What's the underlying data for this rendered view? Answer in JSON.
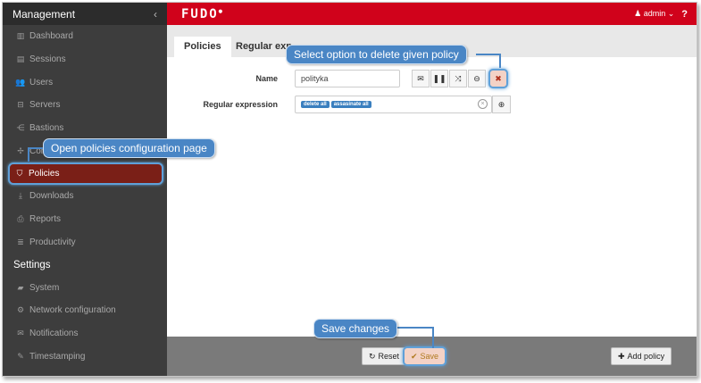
{
  "sidebar": {
    "header": "Management",
    "header_chevron": "‹",
    "items": [
      {
        "label": "Dashboard",
        "icon": "▥"
      },
      {
        "label": "Sessions",
        "icon": "▤"
      },
      {
        "label": "Users",
        "icon": "👥"
      },
      {
        "label": "Servers",
        "icon": "⊟"
      },
      {
        "label": "Bastions",
        "icon": "⋲"
      },
      {
        "label": "Con",
        "icon": "✢"
      },
      {
        "label": "Policies",
        "icon": "⛉"
      },
      {
        "label": "Downloads",
        "icon": "⤓"
      },
      {
        "label": "Reports",
        "icon": "⎙"
      },
      {
        "label": "Productivity",
        "icon": "≣"
      }
    ],
    "settings_header": "Settings",
    "settings_items": [
      {
        "label": "System",
        "icon": "▰"
      },
      {
        "label": "Network configuration",
        "icon": "⚙"
      },
      {
        "label": "Notifications",
        "icon": "✉"
      },
      {
        "label": "Timestamping",
        "icon": "✎"
      }
    ]
  },
  "topbar": {
    "logo": "FUDO",
    "user_label": "admin",
    "user_icon": "♟",
    "user_chevron": "⌄",
    "help": "?"
  },
  "tabs": [
    {
      "label": "Policies"
    },
    {
      "label": "Regular exp"
    }
  ],
  "form": {
    "name_label": "Name",
    "name_value": "polityka",
    "regex_label": "Regular expression",
    "tags": [
      "delete all",
      "assasinate all"
    ],
    "action_icons": [
      "✉",
      "❚❚",
      "⤨",
      "⊖",
      "✖"
    ],
    "search_icon": "⊕",
    "clear_icon": "×"
  },
  "bottom": {
    "reset_label": "Reset",
    "reset_icon": "↻",
    "save_label": "Save",
    "save_icon": "✔",
    "add_label": "Add policy",
    "add_icon": "✚"
  },
  "callouts": {
    "delete": "Select option to delete given policy",
    "policies": "Open policies configuration page",
    "save": "Save changes"
  },
  "colors": {
    "brand_red": "#d0021b",
    "sidebar_bg": "#3d3d3d",
    "callout_blue": "#4a86c5",
    "active_item": "#7a1f17"
  }
}
